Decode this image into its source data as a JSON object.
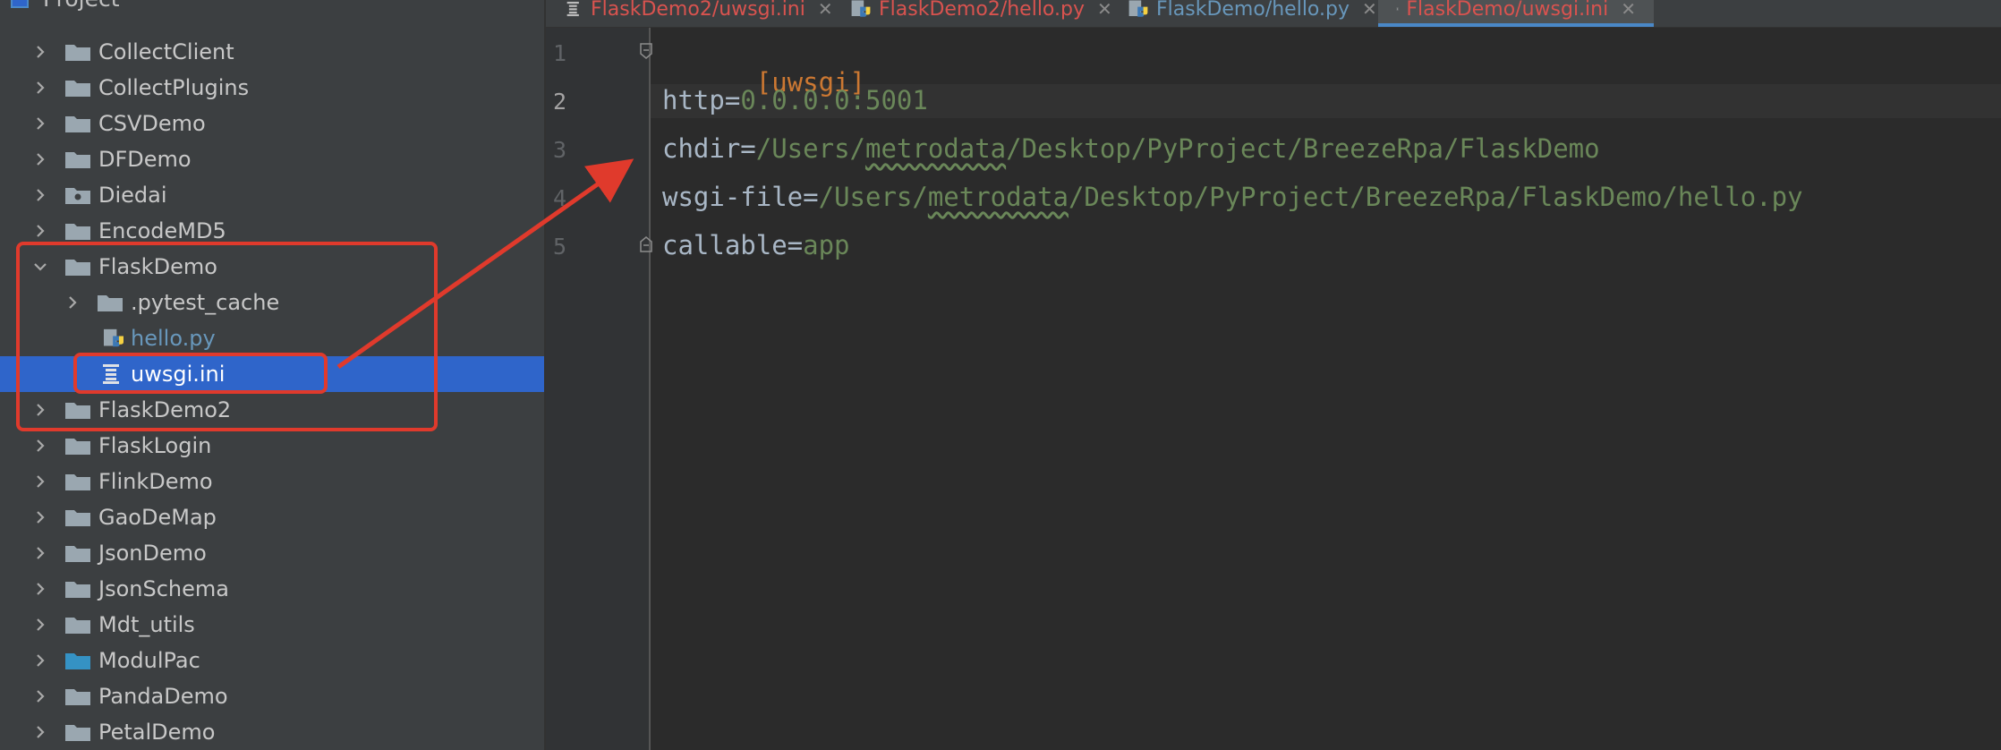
{
  "sidebar": {
    "title": "Project",
    "items": [
      {
        "label": "CollectClient"
      },
      {
        "label": "CollectPlugins"
      },
      {
        "label": "CSVDemo"
      },
      {
        "label": "DFDemo"
      },
      {
        "label": "Diedai"
      },
      {
        "label": "EncodeMD5"
      },
      {
        "label": "FlaskDemo"
      },
      {
        "label": ".pytest_cache"
      },
      {
        "label": "hello.py"
      },
      {
        "label": "uwsgi.ini"
      },
      {
        "label": "FlaskDemo2"
      },
      {
        "label": "FlaskLogin"
      },
      {
        "label": "FlinkDemo"
      },
      {
        "label": "GaoDeMap"
      },
      {
        "label": "JsonDemo"
      },
      {
        "label": "JsonSchema"
      },
      {
        "label": "Mdt_utils"
      },
      {
        "label": "ModulPac"
      },
      {
        "label": "PandaDemo"
      },
      {
        "label": "PetalDemo"
      }
    ]
  },
  "tabs": [
    {
      "label": "FlaskDemo2/uwsgi.ini",
      "icon": "ini-file-icon",
      "color": "#d9534f"
    },
    {
      "label": "FlaskDemo2/hello.py",
      "icon": "python-file-icon",
      "color": "#d9534f"
    },
    {
      "label": "FlaskDemo/hello.py",
      "icon": "python-file-icon",
      "color": "#6897bb"
    },
    {
      "label": "FlaskDemo/uwsgi.ini",
      "icon": "ini-file-icon",
      "color": "#d9534f",
      "active": true
    }
  ],
  "editor": {
    "line_numbers": [
      "1",
      "2",
      "3",
      "4",
      "5"
    ],
    "lines": [
      {
        "section": "[uwsgi]"
      },
      {
        "key": "http=",
        "value": "0.0.0.0:5001"
      },
      {
        "key": "chdir=",
        "value_pre": "/Users/",
        "value_typo": "metrodata",
        "value_post": "/Desktop/PyProject/BreezeRpa/FlaskDemo"
      },
      {
        "key": "wsgi-file=",
        "value_pre": "/Users/",
        "value_typo": "metrodata",
        "value_post": "/Desktop/PyProject/BreezeRpa/FlaskDemo/hello.py"
      },
      {
        "key": "callable=",
        "value": "app"
      }
    ]
  },
  "colors": {
    "accent_selection": "#2f65ca",
    "annotation_red": "#e03a2c",
    "folder_gray": "#9aa7b0",
    "folder_blue": "#3592c4"
  }
}
